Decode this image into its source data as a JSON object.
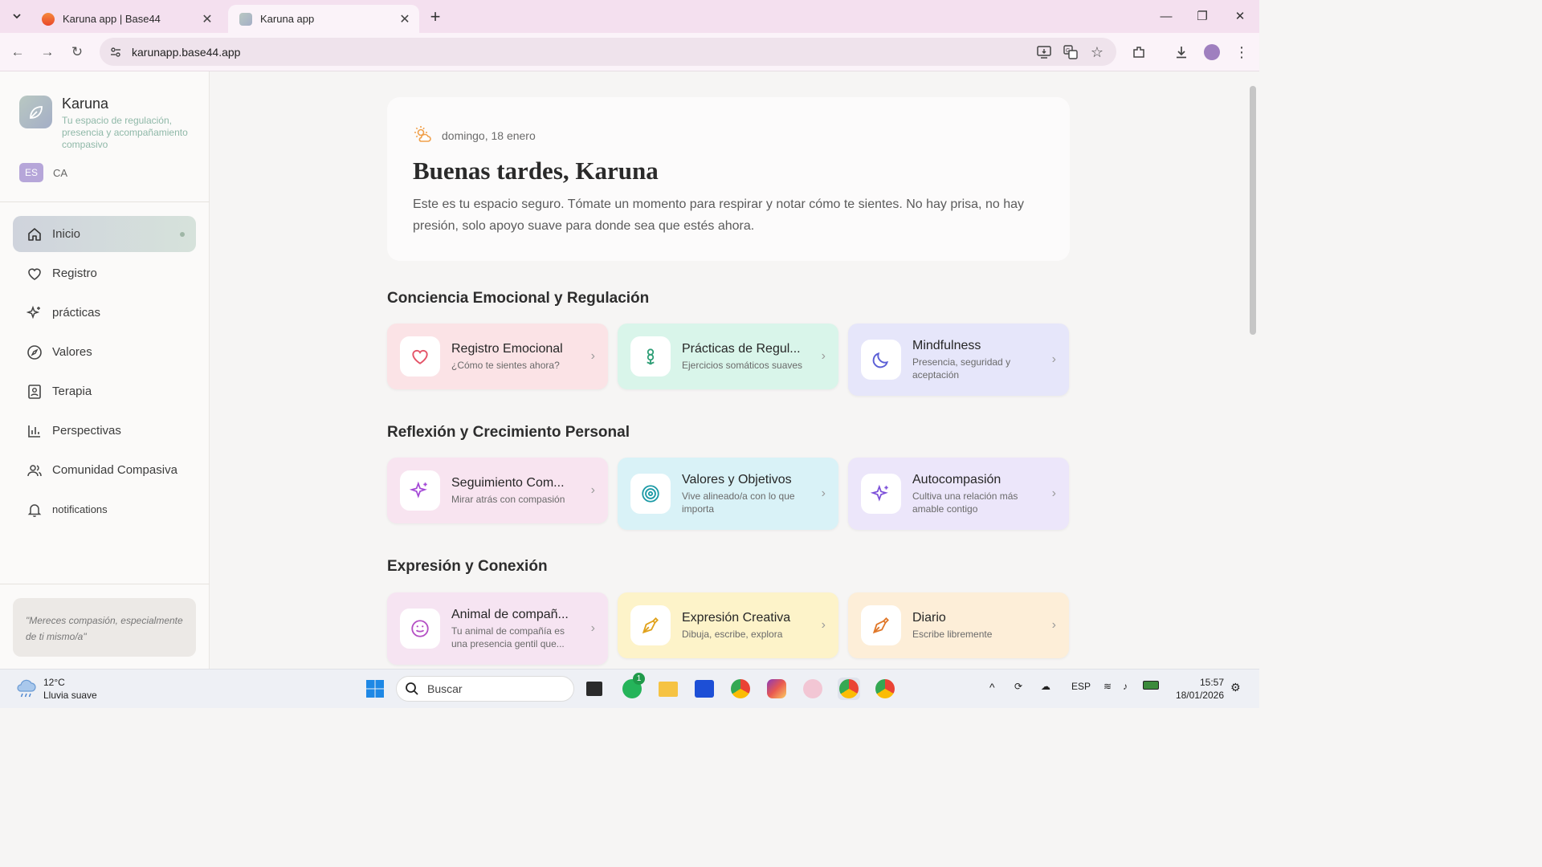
{
  "browser": {
    "tabs": [
      {
        "title": "Karuna app | Base44",
        "active": false
      },
      {
        "title": "Karuna app",
        "active": true
      }
    ],
    "url": "karunapp.base44.app"
  },
  "sidebar": {
    "app_name": "Karuna",
    "tagline": "Tu espacio de regulación, presencia y acompañamiento compasivo",
    "lang_active": "ES",
    "lang_other": "CA",
    "nav": [
      {
        "label": "Inicio",
        "icon": "home-icon",
        "active": true
      },
      {
        "label": "Registro",
        "icon": "heart-icon",
        "active": false
      },
      {
        "label": "prácticas",
        "icon": "sparkles-icon",
        "active": false
      },
      {
        "label": "Valores",
        "icon": "compass-icon",
        "active": false
      },
      {
        "label": "Terapia",
        "icon": "therapy-icon",
        "active": false
      },
      {
        "label": "Perspectivas",
        "icon": "bar-chart-icon",
        "active": false
      },
      {
        "label": "Comunidad Compasiva",
        "icon": "users-icon",
        "active": false
      },
      {
        "label": "notifications",
        "icon": "bell-icon",
        "active": false
      }
    ],
    "quote": "\"Mereces compasión, especialmente de ti mismo/a\""
  },
  "hero": {
    "date": "domingo, 18 enero",
    "greeting": "Buenas tardes, Karuna",
    "message": "Este es tu espacio seguro. Tómate un momento para respirar y notar cómo te sientes. No hay prisa, no hay presión, solo apoyo suave para donde sea que estés ahora."
  },
  "sections": [
    {
      "title": "Conciencia Emocional y Regulación",
      "cards": [
        {
          "title": "Registro Emocional",
          "subtitle": "¿Cómo te sientes ahora?",
          "icon": "heart-icon",
          "color": "#fbe3e6"
        },
        {
          "title": "Prácticas de Regul...",
          "subtitle": "Ejercicios somáticos suaves",
          "icon": "flower-icon",
          "color": "#d9f5ea"
        },
        {
          "title": "Mindfulness",
          "subtitle": "Presencia, seguridad y aceptación",
          "icon": "moon-icon",
          "color": "#e6e6fa"
        }
      ]
    },
    {
      "title": "Reflexión y Crecimiento Personal",
      "cards": [
        {
          "title": "Seguimiento Com...",
          "subtitle": "Mirar atrás con compasión",
          "icon": "sparkles-icon",
          "color": "#f8e4f0"
        },
        {
          "title": "Valores y Objetivos",
          "subtitle": "Vive alineado/a con lo que importa",
          "icon": "target-icon",
          "color": "#d9f2f7"
        },
        {
          "title": "Autocompasión",
          "subtitle": "Cultiva una relación más amable contigo",
          "icon": "sparkles-icon",
          "color": "#ece6fa"
        }
      ]
    },
    {
      "title": "Expresión y Conexión",
      "cards": [
        {
          "title": "Animal de compañ...",
          "subtitle": "Tu animal de compañía es una presencia gentil que...",
          "icon": "smile-icon",
          "color": "#f6e4f2"
        },
        {
          "title": "Expresión Creativa",
          "subtitle": "Dibuja, escribe, explora",
          "icon": "pen-icon",
          "color": "#fdf3c9"
        },
        {
          "title": "Diario",
          "subtitle": "Escribe libremente",
          "icon": "pen-icon",
          "color": "#fdeed8"
        }
      ]
    }
  ],
  "taskbar": {
    "temp": "12°C",
    "weather": "Lluvia suave",
    "search_placeholder": "Buscar",
    "whatsapp_badge": "1",
    "lang": "ESP",
    "time": "15:57",
    "date": "18/01/2026"
  }
}
